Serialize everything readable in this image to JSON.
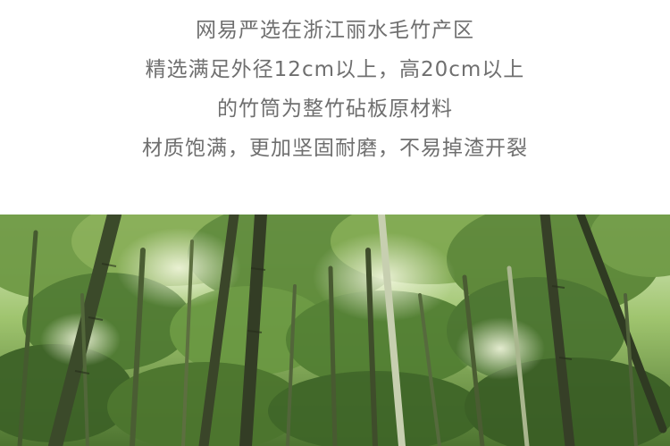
{
  "description_lines": [
    "网易严选在浙江丽水毛竹产区",
    "精选满足外径12cm以上，高20cm以上",
    "的竹筒为整竹砧板原材料",
    "材质饱满，更加坚固耐磨，不易掉渣开裂"
  ],
  "colors": {
    "text": "#6f6f6f",
    "background": "#ffffff",
    "foliage_light": "#b9d98a",
    "foliage_mid": "#6f9a45",
    "foliage_dark": "#2f4f22",
    "trunk_dark": "#3a3f2c"
  }
}
